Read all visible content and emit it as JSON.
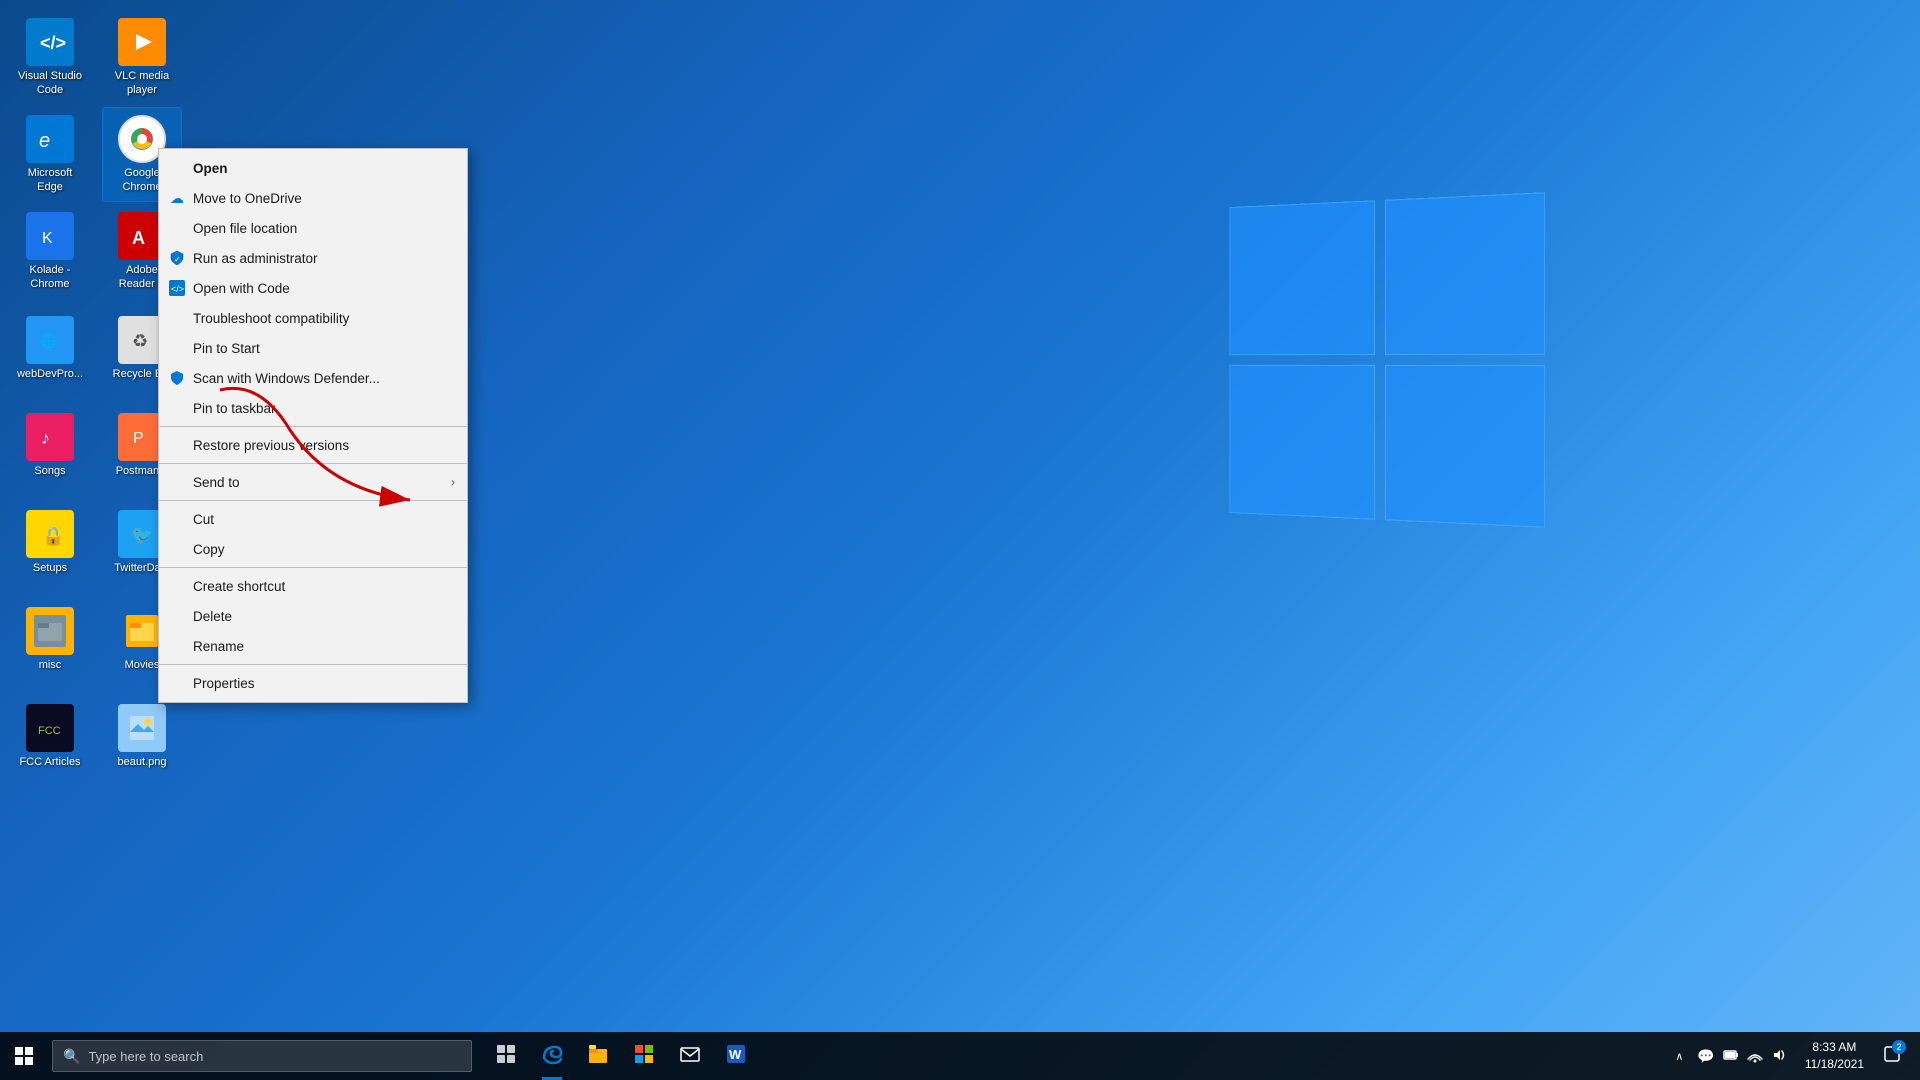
{
  "desktop": {
    "icons": [
      {
        "id": "visual-studio-code",
        "label": "Visual Studio\nCode",
        "icon_class": "icon-vscode",
        "icon_char": "⬛",
        "col": 1,
        "row": 1
      },
      {
        "id": "vlc-media-player",
        "label": "VLC media\nplayer",
        "icon_class": "icon-vlc",
        "icon_char": "🔶",
        "col": 2,
        "row": 1
      },
      {
        "id": "microsoft-edge",
        "label": "Microsoft\nEdge",
        "icon_class": "icon-edge",
        "icon_char": "e",
        "col": 1,
        "row": 2
      },
      {
        "id": "google-chrome",
        "label": "Google\nChrome",
        "icon_class": "icon-chrome",
        "icon_char": "◉",
        "col": 2,
        "row": 2,
        "selected": true
      },
      {
        "id": "kolade-chrome",
        "label": "Kolade -\nChrome",
        "icon_class": "icon-kolade",
        "icon_char": "K",
        "col": 1,
        "row": 3
      },
      {
        "id": "adobe-reader",
        "label": "Adobe\nReader X",
        "icon_class": "icon-adobe",
        "icon_char": "A",
        "col": 2,
        "row": 3
      },
      {
        "id": "webdev-pro",
        "label": "webDevPro...",
        "icon_class": "icon-webdev",
        "icon_char": "W",
        "col": 1,
        "row": 4
      },
      {
        "id": "recycle-bin",
        "label": "Recycle B...",
        "icon_class": "icon-recycle",
        "icon_char": "♻",
        "col": 2,
        "row": 4
      },
      {
        "id": "songs",
        "label": "Songs",
        "icon_class": "icon-songs",
        "icon_char": "♪",
        "col": 1,
        "row": 5
      },
      {
        "id": "postman",
        "label": "Postman...",
        "icon_class": "icon-postman",
        "icon_char": "📮",
        "col": 2,
        "row": 5
      },
      {
        "id": "setups",
        "label": "Setups",
        "icon_class": "icon-setups",
        "icon_char": "🔒",
        "col": 1,
        "row": 6
      },
      {
        "id": "twitter-da",
        "label": "TwitterDa...",
        "icon_class": "icon-twitter",
        "icon_char": "🐦",
        "col": 2,
        "row": 6
      },
      {
        "id": "misc",
        "label": "misc",
        "icon_class": "icon-misc",
        "icon_char": "📁",
        "col": 1,
        "row": 7
      },
      {
        "id": "movies",
        "label": "Movies",
        "icon_class": "icon-movies",
        "icon_char": "📁",
        "col": 2,
        "row": 7
      },
      {
        "id": "fcc-articles",
        "label": "FCC Articles",
        "icon_class": "icon-fcc",
        "icon_char": "📄",
        "col": 1,
        "row": 8
      },
      {
        "id": "beaut-png",
        "label": "beaut.png",
        "icon_class": "icon-beaut",
        "icon_char": "🖼",
        "col": 2,
        "row": 8
      }
    ]
  },
  "context_menu": {
    "items": [
      {
        "id": "open",
        "label": "Open",
        "bold": true,
        "icon": "",
        "separator_after": false
      },
      {
        "id": "move-to-onedrive",
        "label": "Move to OneDrive",
        "bold": false,
        "icon": "☁",
        "icon_class": "cloud-icon",
        "separator_after": false
      },
      {
        "id": "open-file-location",
        "label": "Open file location",
        "bold": false,
        "icon": "",
        "separator_after": false
      },
      {
        "id": "run-as-admin",
        "label": "Run as administrator",
        "bold": false,
        "icon": "🛡",
        "icon_class": "defender-icon",
        "separator_after": false
      },
      {
        "id": "open-with-code",
        "label": "Open with Code",
        "bold": false,
        "icon": "◀",
        "icon_class": "vscode-icon-sm",
        "separator_after": false
      },
      {
        "id": "troubleshoot-compat",
        "label": "Troubleshoot compatibility",
        "bold": false,
        "icon": "",
        "separator_after": false
      },
      {
        "id": "pin-to-start",
        "label": "Pin to Start",
        "bold": false,
        "icon": "",
        "separator_after": false
      },
      {
        "id": "scan-defender",
        "label": "Scan with Windows Defender...",
        "bold": false,
        "icon": "🛡",
        "icon_class": "defender-icon",
        "separator_after": false
      },
      {
        "id": "pin-to-taskbar",
        "label": "Pin to taskbar",
        "bold": false,
        "icon": "",
        "separator_after": true
      },
      {
        "id": "restore-previous",
        "label": "Restore previous versions",
        "bold": false,
        "icon": "",
        "separator_after": true
      },
      {
        "id": "send-to",
        "label": "Send to",
        "bold": false,
        "icon": "",
        "has_arrow": true,
        "separator_after": true
      },
      {
        "id": "cut",
        "label": "Cut",
        "bold": false,
        "icon": "",
        "separator_after": false
      },
      {
        "id": "copy",
        "label": "Copy",
        "bold": false,
        "icon": "",
        "separator_after": true
      },
      {
        "id": "create-shortcut",
        "label": "Create shortcut",
        "bold": false,
        "icon": "",
        "separator_after": false
      },
      {
        "id": "delete",
        "label": "Delete",
        "bold": false,
        "icon": "",
        "separator_after": false
      },
      {
        "id": "rename",
        "label": "Rename",
        "bold": false,
        "icon": "",
        "separator_after": true
      },
      {
        "id": "properties",
        "label": "Properties",
        "bold": false,
        "icon": "",
        "separator_after": false
      }
    ]
  },
  "taskbar": {
    "search_placeholder": "Type here to search",
    "clock_time": "8:33 AM",
    "clock_date": "11/18/2021",
    "notification_count": "2"
  }
}
